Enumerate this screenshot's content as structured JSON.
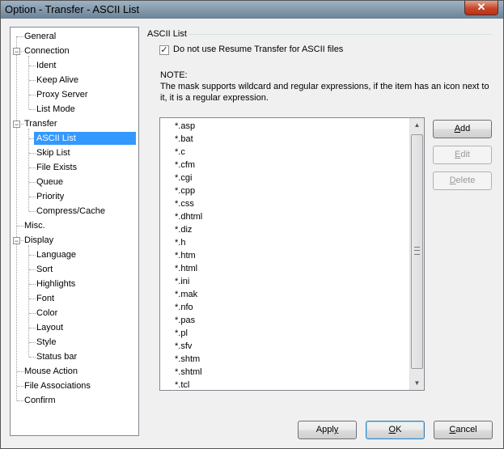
{
  "window": {
    "title": "Option - Transfer - ASCII List",
    "close_glyph": "✕"
  },
  "tree": {
    "items": [
      {
        "label": "General",
        "level": 0,
        "toggle": ""
      },
      {
        "label": "Connection",
        "level": 0,
        "toggle": "−"
      },
      {
        "label": "Ident",
        "level": 1,
        "toggle": ""
      },
      {
        "label": "Keep Alive",
        "level": 1,
        "toggle": ""
      },
      {
        "label": "Proxy Server",
        "level": 1,
        "toggle": ""
      },
      {
        "label": "List Mode",
        "level": 1,
        "toggle": ""
      },
      {
        "label": "Transfer",
        "level": 0,
        "toggle": "−"
      },
      {
        "label": "ASCII List",
        "level": 1,
        "toggle": "",
        "selected": true
      },
      {
        "label": "Skip List",
        "level": 1,
        "toggle": ""
      },
      {
        "label": "File Exists",
        "level": 1,
        "toggle": ""
      },
      {
        "label": "Queue",
        "level": 1,
        "toggle": ""
      },
      {
        "label": "Priority",
        "level": 1,
        "toggle": ""
      },
      {
        "label": "Compress/Cache",
        "level": 1,
        "toggle": ""
      },
      {
        "label": "Misc.",
        "level": 0,
        "toggle": ""
      },
      {
        "label": "Display",
        "level": 0,
        "toggle": "−"
      },
      {
        "label": "Language",
        "level": 1,
        "toggle": ""
      },
      {
        "label": "Sort",
        "level": 1,
        "toggle": ""
      },
      {
        "label": "Highlights",
        "level": 1,
        "toggle": ""
      },
      {
        "label": "Font",
        "level": 1,
        "toggle": ""
      },
      {
        "label": "Color",
        "level": 1,
        "toggle": ""
      },
      {
        "label": "Layout",
        "level": 1,
        "toggle": ""
      },
      {
        "label": "Style",
        "level": 1,
        "toggle": ""
      },
      {
        "label": "Status bar",
        "level": 1,
        "toggle": ""
      },
      {
        "label": "Mouse Action",
        "level": 0,
        "toggle": ""
      },
      {
        "label": "File Associations",
        "level": 0,
        "toggle": ""
      },
      {
        "label": "Confirm",
        "level": 0,
        "toggle": ""
      }
    ]
  },
  "panel": {
    "group_title": "ASCII List",
    "checkbox": {
      "label": "Do not use Resume Transfer for ASCII files",
      "checked": true,
      "glyph": "✓"
    },
    "note_title": "NOTE:",
    "note_text": " The mask supports wildcard and regular expressions, if the item has an icon next to it, it is a regular expression.",
    "masks": [
      "*.asp",
      "*.bat",
      "*.c",
      "*.cfm",
      "*.cgi",
      "*.cpp",
      "*.css",
      "*.dhtml",
      "*.diz",
      "*.h",
      "*.htm",
      "*.html",
      "*.ini",
      "*.mak",
      "*.nfo",
      "*.pas",
      "*.pl",
      "*.sfv",
      "*.shtm",
      "*.shtml",
      "*.tcl"
    ],
    "scroll_up": "▲",
    "scroll_down": "▼"
  },
  "side_buttons": {
    "add": {
      "mnemonic": "A",
      "rest": "dd"
    },
    "edit": {
      "mnemonic": "E",
      "rest": "dit"
    },
    "delete": {
      "mnemonic": "D",
      "rest": "elete"
    }
  },
  "footer_buttons": {
    "apply": {
      "pre": "Appl",
      "mnemonic": "y",
      "post": ""
    },
    "ok": {
      "pre": "",
      "mnemonic": "O",
      "post": "K"
    },
    "cancel": {
      "pre": "",
      "mnemonic": "C",
      "post": "ancel"
    }
  }
}
